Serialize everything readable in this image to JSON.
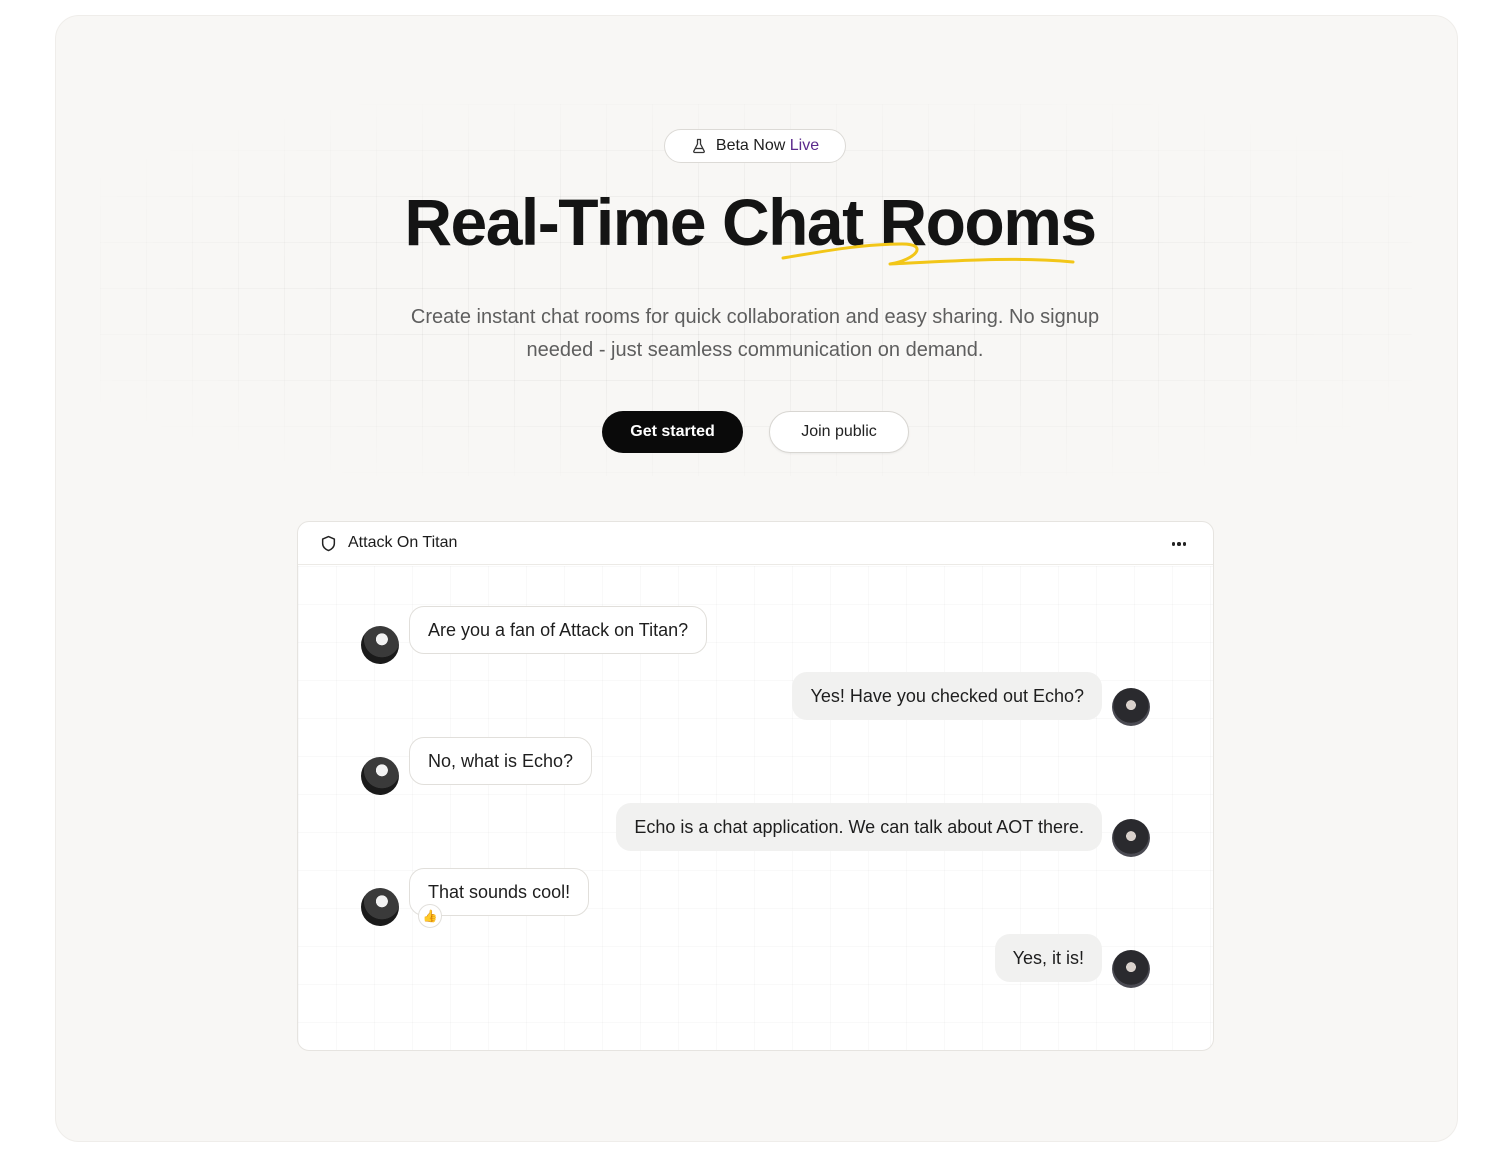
{
  "hero": {
    "badge": {
      "icon": "flask-icon",
      "label_main": "Beta Now",
      "label_accent": "Live"
    },
    "title": "Real-Time Chat Rooms",
    "subtitle": "Create instant chat rooms for quick collaboration and easy sharing. No signup needed - just seamless communication on demand.",
    "primary_button": "Get started",
    "secondary_button": "Join public"
  },
  "chat": {
    "room_icon": "shield-icon",
    "room_name": "Attack On Titan",
    "menu_icon": "more-horizontal-icon",
    "messages": [
      {
        "side": "incoming",
        "text": "Are you a fan of Attack on Titan?"
      },
      {
        "side": "outgoing",
        "text": "Yes! Have you checked out Echo?"
      },
      {
        "side": "incoming",
        "text": "No, what is Echo?"
      },
      {
        "side": "outgoing",
        "text": "Echo is a chat application. We can talk about AOT there."
      },
      {
        "side": "incoming",
        "text": "That sounds cool!",
        "reaction": "👍"
      },
      {
        "side": "outgoing",
        "text": "Yes, it is!"
      }
    ]
  },
  "colors": {
    "page_bg": "#f8f7f5",
    "accent_squiggle": "#f2c618",
    "badge_accent": "#5b2a8c",
    "primary_button_bg": "#0a0a0a",
    "outgoing_bubble_bg": "#f1f1f0"
  }
}
